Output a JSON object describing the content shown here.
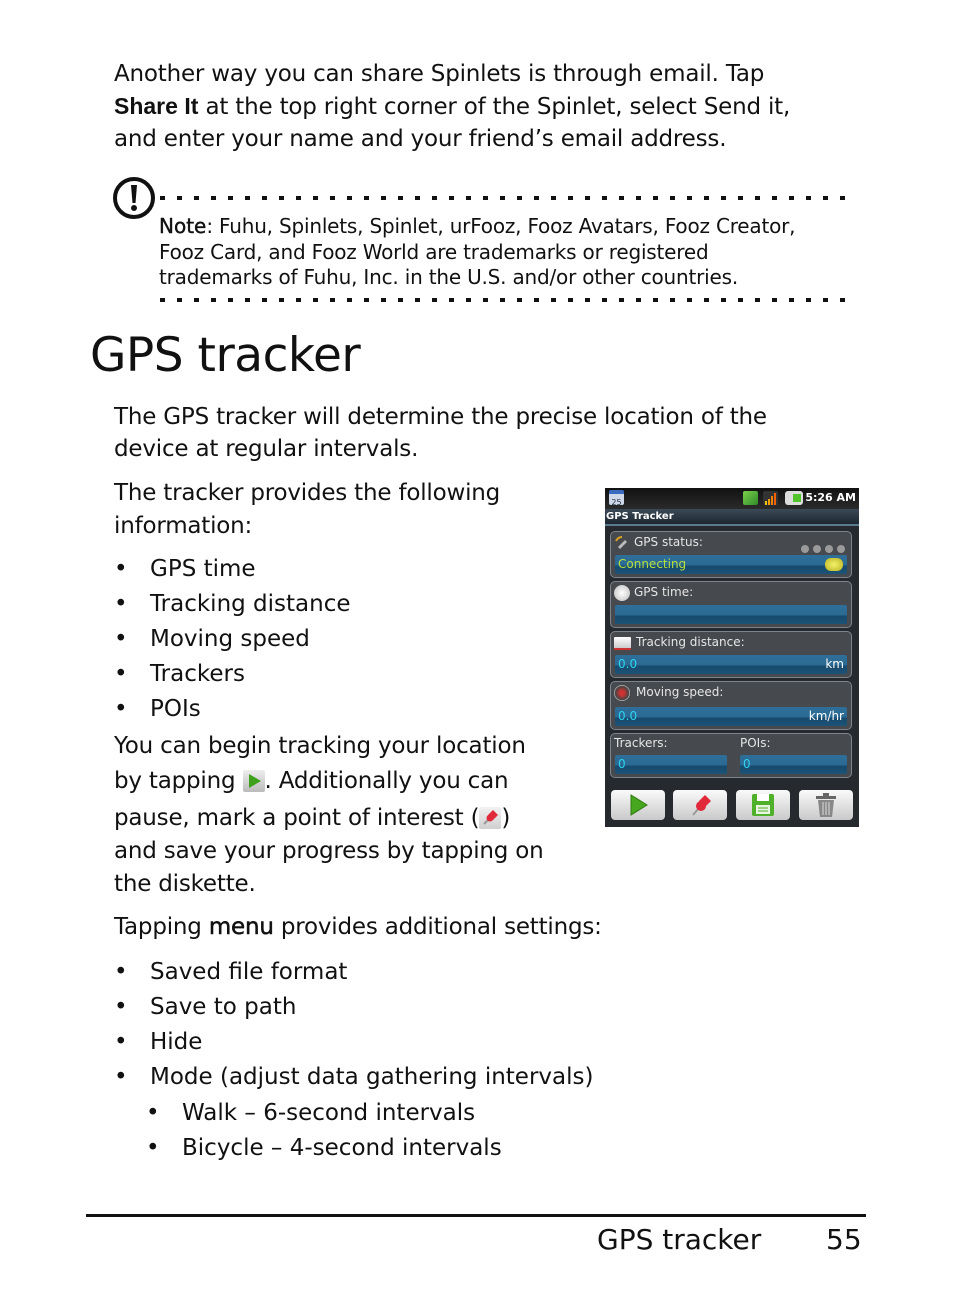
{
  "intro": {
    "line1": "Another way you can share Spinlets is through email. Tap",
    "share_it": "Share It",
    "line2_rest": " at the top right corner of the Spinlet, select Send it,",
    "line3": "and enter your name and your friend’s email address."
  },
  "note": {
    "icon": "exclamation-circle-icon",
    "label": "Note",
    "line1_rest": ": Fuhu, Spinlets, Spinlet, urFooz, Fooz Avatars, Fooz Creator,",
    "line2": "Fooz Card, and Fooz World are trademarks or registered",
    "line3": "trademarks of Fuhu, Inc. in the U.S. and/or other countries."
  },
  "heading": "GPS tracker",
  "description": {
    "line1": "The GPS tracker will determine the precise location of the",
    "line2": "device at regular intervals."
  },
  "info_intro": {
    "line1": "The tracker provides the following",
    "line2": "information:"
  },
  "info_items": [
    "GPS time",
    "Tracking distance",
    "Moving speed",
    "Trackers",
    "POIs"
  ],
  "tracking_text": {
    "line1": "You can begin tracking your location",
    "line2a": "by tapping ",
    "line2b": ". Additionally you can",
    "line3a": "pause, mark a point of interest (",
    "line3b": ")",
    "line4": "and save your progress by tapping on",
    "line5": "the diskette.",
    "play_icon": "play-icon",
    "pin_icon": "pushpin-icon"
  },
  "menu_text": {
    "prefix": "Tapping ",
    "menu": "menu",
    "suffix": " provides additional settings:"
  },
  "menu_items": [
    "Saved file format",
    "Save to path",
    "Hide",
    "Mode (adjust data gathering intervals)"
  ],
  "mode_items": [
    "Walk – 6-second intervals",
    "Bicycle – 4-second intervals"
  ],
  "phone": {
    "status_bar": {
      "calendar_day": "25",
      "time": "5:26 AM",
      "icons": [
        "calendar-icon",
        "gps-notification-icon",
        "signal-icon",
        "battery-icon"
      ]
    },
    "app_title": "GPS Tracker",
    "gps_status": {
      "label": "GPS status:",
      "value": "Connecting",
      "satellite_dots": 4
    },
    "gps_time": {
      "label": "GPS time:",
      "value": ""
    },
    "tracking_distance": {
      "label": "Tracking distance:",
      "value": "0.0",
      "unit": "km"
    },
    "moving_speed": {
      "label": "Moving speed:",
      "value": "0.0",
      "unit": "km/hr"
    },
    "trackers": {
      "label": "Trackers:",
      "value": "0"
    },
    "pois": {
      "label": "POIs:",
      "value": "0"
    },
    "buttons": [
      "play",
      "mark-poi",
      "save",
      "delete"
    ],
    "colors": {
      "connecting_text": "#b8e03a",
      "value_text": "#2fd4f0",
      "field_bg": "#2a6a93"
    }
  },
  "footer": {
    "section": "GPS tracker",
    "page": "55"
  }
}
